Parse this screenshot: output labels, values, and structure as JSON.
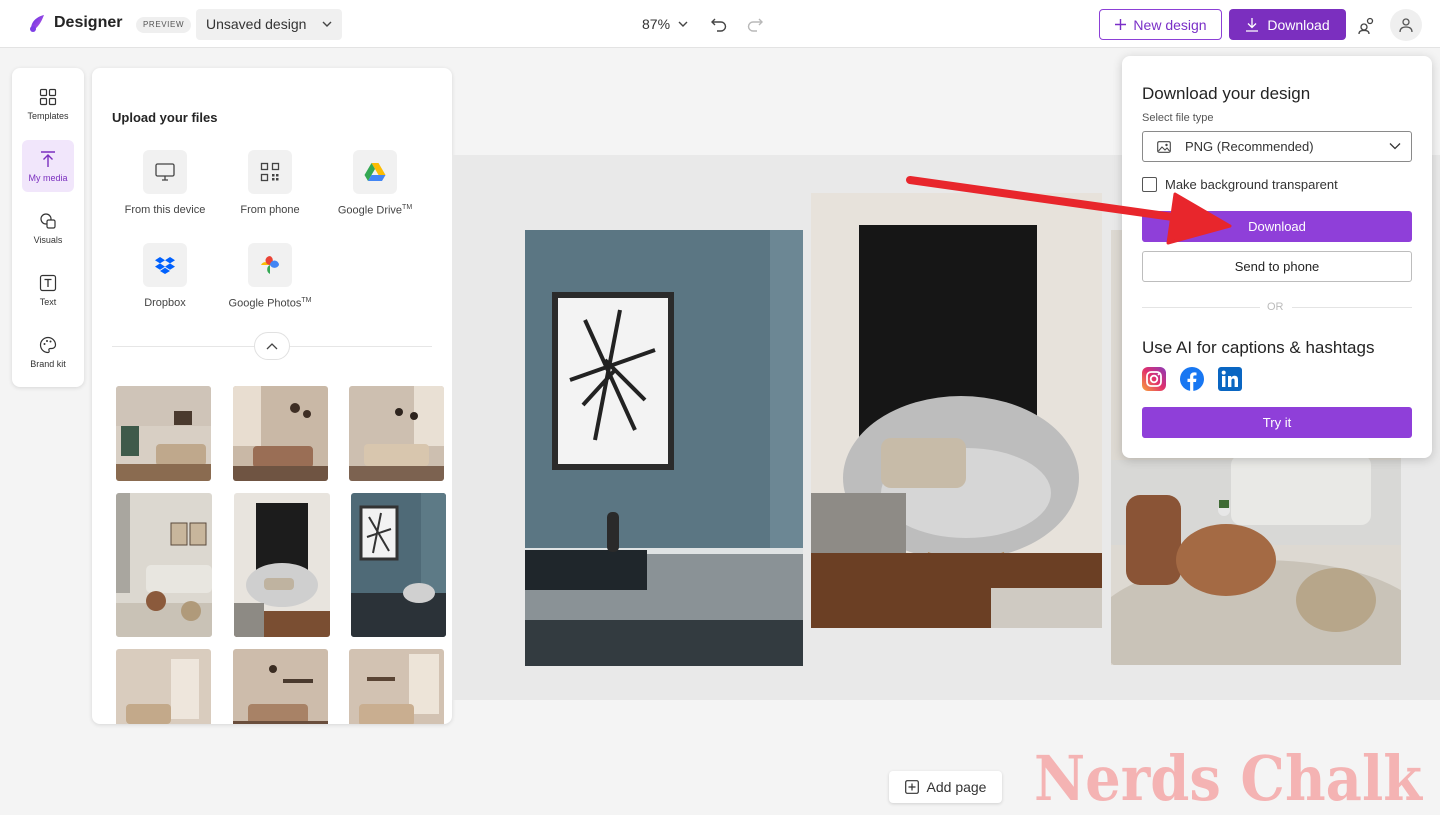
{
  "app": {
    "name": "Designer",
    "badge": "PREVIEW",
    "design_name": "Unsaved design",
    "zoom": "87%",
    "new_design_label": "New design",
    "download_label": "Download"
  },
  "rail": {
    "items": [
      {
        "label": "Templates",
        "icon": "templates-icon",
        "active": false
      },
      {
        "label": "My media",
        "icon": "upload-icon",
        "active": true
      },
      {
        "label": "Visuals",
        "icon": "visuals-icon",
        "active": false
      },
      {
        "label": "Text",
        "icon": "text-icon",
        "active": false
      },
      {
        "label": "Brand kit",
        "icon": "palette-icon",
        "active": false
      }
    ]
  },
  "panel": {
    "title": "Upload your files",
    "sources": [
      {
        "label": "From this device",
        "icon": "monitor-icon",
        "tm": ""
      },
      {
        "label": "From phone",
        "icon": "qr-code-icon",
        "tm": ""
      },
      {
        "label": "Google Drive",
        "icon": "google-drive-icon",
        "tm": "TM"
      },
      {
        "label": "Dropbox",
        "icon": "dropbox-icon",
        "tm": ""
      },
      {
        "label": "Google Photos",
        "icon": "google-photos-icon",
        "tm": "TM"
      }
    ]
  },
  "canvas": {
    "add_page_label": "Add page"
  },
  "download_popup": {
    "title": "Download your design",
    "file_type_label": "Select file type",
    "file_type_value": "PNG (Recommended)",
    "transparent_label": "Make background transparent",
    "download_button": "Download",
    "send_to_phone_button": "Send to phone",
    "or_text": "OR",
    "ai_title": "Use AI for captions & hashtags",
    "try_button": "Try it",
    "socials": [
      "instagram-icon",
      "facebook-icon",
      "linkedin-icon"
    ]
  },
  "watermark": "Nerds Chalk",
  "colors": {
    "accent": "#8f3fd9",
    "accent_dark": "#7b2fbf",
    "arrow": "#e8262c",
    "watermark": "#f4b3b3"
  }
}
